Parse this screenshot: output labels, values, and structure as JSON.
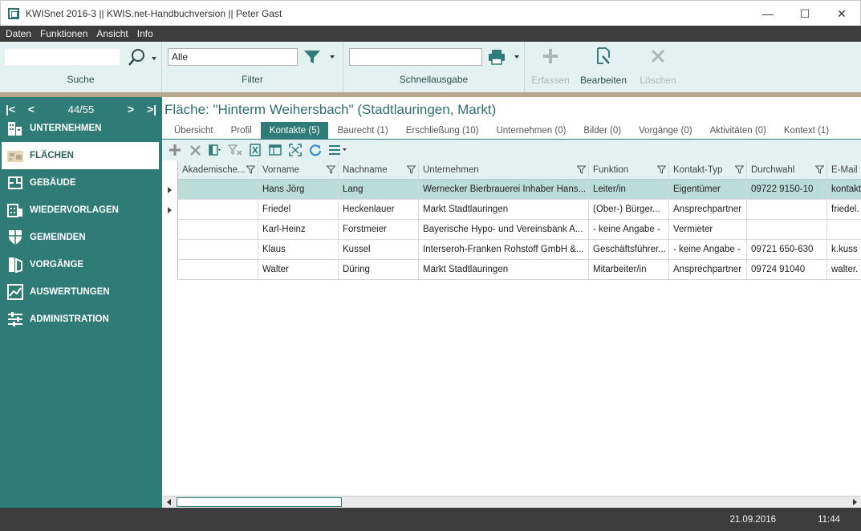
{
  "window": {
    "title": "KWISnet 2016-3 || KWIS.net-Handbuchversion || Peter Gast",
    "minimize": "—",
    "maximize": "☐",
    "close": "✕"
  },
  "menu": [
    "Daten",
    "Funktionen",
    "Ansicht",
    "Info"
  ],
  "ribbon": {
    "search": {
      "value": "",
      "label": "Suche",
      "icon": "magnifier-icon"
    },
    "filter": {
      "value": "Alle",
      "label": "Filter",
      "icon": "funnel-icon"
    },
    "quick_output": {
      "value": "",
      "label": "Schnellausgabe",
      "icon": "printer-icon"
    },
    "buttons": [
      {
        "label": "Erfassen",
        "icon": "plus-icon",
        "enabled": false
      },
      {
        "label": "Bearbeiten",
        "icon": "edit-document-icon",
        "enabled": true
      },
      {
        "label": "Löschen",
        "icon": "x-icon",
        "enabled": false
      }
    ],
    "colors": {
      "background": "#e3f1f0",
      "accent": "#b6a88a",
      "primary": "#2f7b78"
    }
  },
  "sidebar": {
    "pager": "44/55",
    "items": [
      {
        "label": "UNTERNEHMEN",
        "icon": "building-icon",
        "active": false
      },
      {
        "label": "FLÄCHEN",
        "icon": "area-plot-icon",
        "active": true
      },
      {
        "label": "GEBÄUDE",
        "icon": "floorplan-icon",
        "active": false
      },
      {
        "label": "WIEDERVORLAGEN",
        "icon": "calendar-icon",
        "active": false
      },
      {
        "label": "GEMEINDEN",
        "icon": "shield-icon",
        "active": false
      },
      {
        "label": "VORGÄNGE",
        "icon": "door-icon",
        "active": false
      },
      {
        "label": "AUSWERTUNGEN",
        "icon": "chart-icon",
        "active": false
      },
      {
        "label": "ADMINISTRATION",
        "icon": "sliders-icon",
        "active": false
      }
    ]
  },
  "main": {
    "title": "Fläche: \"Hinterm Weihersbach\" (Stadtlauringen, Markt)",
    "tabs": [
      {
        "label": "Übersicht",
        "active": false
      },
      {
        "label": "Profil",
        "active": false
      },
      {
        "label": "Kontakte (5)",
        "active": true
      },
      {
        "label": "Baurecht (1)",
        "active": false
      },
      {
        "label": "Erschließung (10)",
        "active": false
      },
      {
        "label": "Unternehmen (0)",
        "active": false
      },
      {
        "label": "Bilder (0)",
        "active": false
      },
      {
        "label": "Vorgänge (0)",
        "active": false
      },
      {
        "label": "Aktivitäten (0)",
        "active": false
      },
      {
        "label": "Kontext (1)",
        "active": false
      }
    ],
    "grid": {
      "columns": [
        "Akademische...",
        "Vorname",
        "Nachname",
        "Unternehmen",
        "Funktion",
        "Kontakt-Typ",
        "Durchwahl",
        "E-Mail"
      ],
      "rows": [
        [
          "",
          "Hans Jörg",
          "Lang",
          "Wernecker Bierbrauerei Inhaber Hans...",
          "Leiter/in",
          "Eigentümer",
          "09722 9150-10",
          "kontakt"
        ],
        [
          "",
          "Friedel",
          "Heckenlauer",
          "Markt Stadtlauringen",
          "(Ober-) Bürger...",
          "Ansprechpartner",
          "",
          "friedel."
        ],
        [
          "",
          "Karl-Heinz",
          "Forstmeier",
          "Bayerische Hypo- und Vereinsbank A...",
          "- keine Angabe -",
          "Vermieter",
          "",
          ""
        ],
        [
          "",
          "Klaus",
          "Kussel",
          "Interseroh-Franken Rohstoff GmbH &...",
          "Geschäftsführer...",
          "- keine Angabe -",
          "09721 650-630",
          "k.kuss"
        ],
        [
          "",
          "Walter",
          "Düring",
          "Markt Stadtlauringen",
          "Mitarbeiter/in",
          "Ansprechpartner",
          "09724 91040",
          "walter."
        ]
      ],
      "selected_row": 0,
      "row_pointer": 1
    }
  },
  "status": {
    "date": "21.09.2016",
    "time": "11:44"
  }
}
